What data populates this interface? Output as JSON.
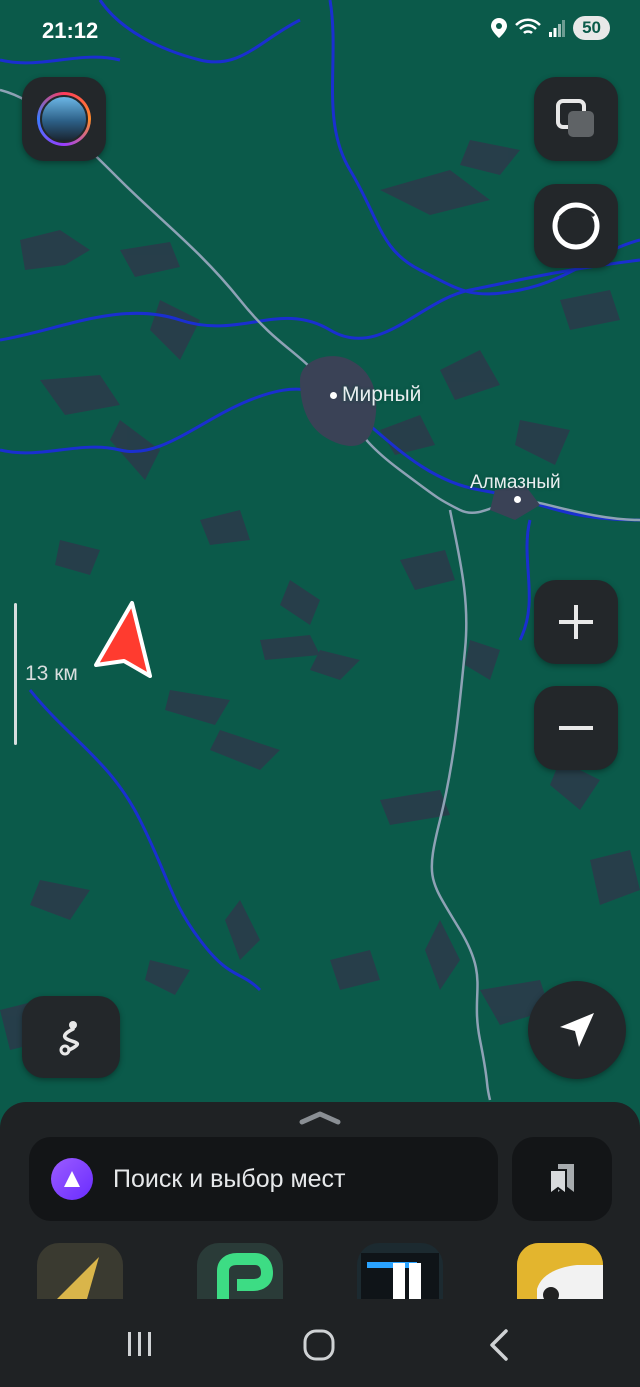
{
  "status_bar": {
    "time": "21:12",
    "battery": "50",
    "icons": [
      "location-icon",
      "wifi-icon",
      "signal-icon"
    ]
  },
  "map": {
    "cities": [
      {
        "name": "Мирный"
      },
      {
        "name": "Алмазный"
      }
    ],
    "scale_label": "13 км",
    "colors": {
      "land": "#0b5a4a",
      "river": "#1a2fd0",
      "road": "#8ea2b5",
      "city": "#3a4256",
      "marker": "#ff3b2f"
    }
  },
  "controls": {
    "icons": [
      "avatar",
      "layers-icon",
      "alice-icon",
      "plus-icon",
      "minus-icon",
      "route-icon",
      "locate-icon"
    ]
  },
  "bottom_sheet": {
    "search_placeholder": "Поиск и выбор мест",
    "bookmarks_icon": "bookmark-icon",
    "apps": [
      "navigator",
      "parking",
      "metro",
      "taxi"
    ]
  },
  "system_nav": {
    "icons": [
      "recent-apps-icon",
      "home-icon",
      "back-icon"
    ]
  }
}
